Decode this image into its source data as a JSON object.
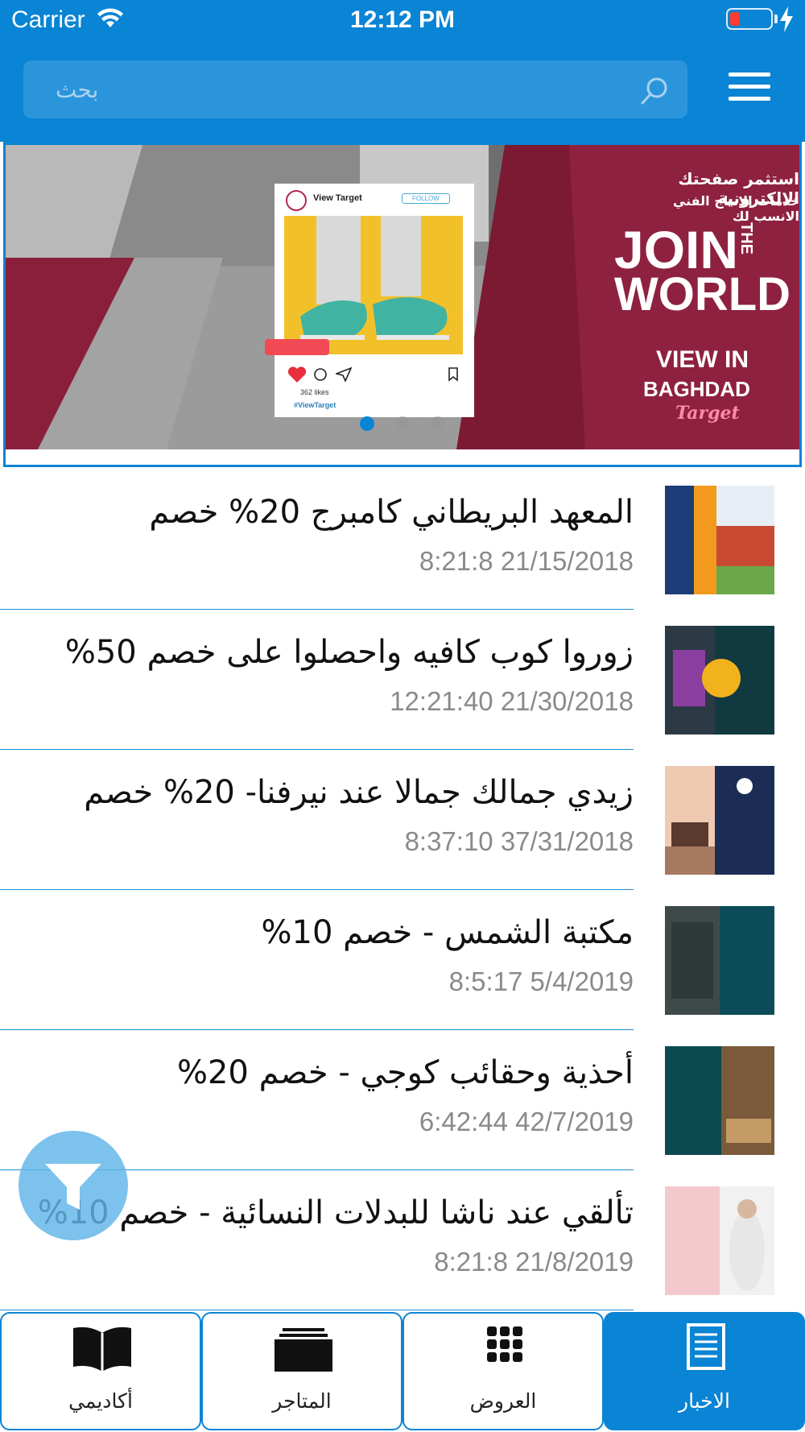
{
  "status_bar": {
    "carrier": "Carrier",
    "time": "12:12 PM"
  },
  "search": {
    "placeholder": "بحث"
  },
  "banner": {
    "headline_ar_1": "استثمر صفحتك الالكترونية",
    "headline_ar_2": "خدمات الانتاج الفني الانسب لك",
    "join": "JOIN",
    "the": "THE",
    "world": "WORLD",
    "view_in": "VIEW IN",
    "baghdad": "BAGHDAD",
    "target": "Target",
    "post_account": "View Target",
    "post_follow": "FOLLOW",
    "post_likes": "362 likes",
    "post_hashtag": "#ViewTarget",
    "slides_total": 3,
    "active_slide": 1
  },
  "news": [
    {
      "title": "المعهد البريطاني كامبرج 20% خصم",
      "date": "8:21:8 21/15/2018"
    },
    {
      "title": "زوروا كوب كافيه واحصلوا على خصم 50%",
      "date": "12:21:40 21/30/2018"
    },
    {
      "title": "زيدي جمالك جمالا عند نيرفنا- 20% خصم",
      "date": "8:37:10 37/31/2018"
    },
    {
      "title": "مكتبة الشمس - خصم 10%",
      "date": "8:5:17 5/4/2019"
    },
    {
      "title": "أحذية وحقائب كوجي - خصم 20%",
      "date": "6:42:44 42/7/2019"
    },
    {
      "title": "تألقي عند ناشا للبدلات النسائية - خصم 10%",
      "date": "8:21:8 21/8/2019"
    }
  ],
  "tabs": [
    {
      "label": "أكاديمي",
      "icon": "book-icon"
    },
    {
      "label": "المتاجر",
      "icon": "stores-icon"
    },
    {
      "label": "العروض",
      "icon": "grid-icon"
    },
    {
      "label": "الاخبار",
      "icon": "news-icon",
      "active": true
    }
  ],
  "colors": {
    "primary": "#0a84d4",
    "search_bg": "#2b95dc",
    "date_gray": "#8a8a8a",
    "fab": "#5fb4e8"
  }
}
